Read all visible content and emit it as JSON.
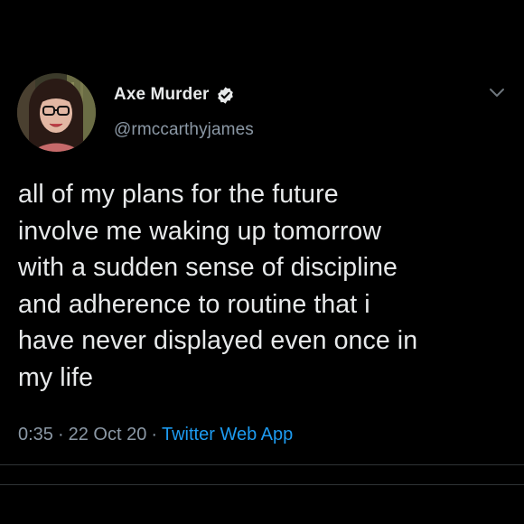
{
  "tweet": {
    "display_name": "Axe Murder",
    "handle": "@rmccarthyjames",
    "verified": true,
    "text": "all of my plans for the future\ninvolve me waking up tomorrow\nwith a sudden sense of discipline\nand adherence to routine that i\nhave never displayed even once in\nmy life",
    "time": "0:35",
    "date": "22 Oct 20",
    "separator": "·",
    "source": "Twitter Web App"
  },
  "icons": {
    "verified": "verified-badge-icon",
    "menu": "chevron-down-icon"
  },
  "colors": {
    "background": "#000000",
    "primary_text": "#e7e9ea",
    "secondary_text": "#8b98a5",
    "accent": "#1d9bf0"
  }
}
